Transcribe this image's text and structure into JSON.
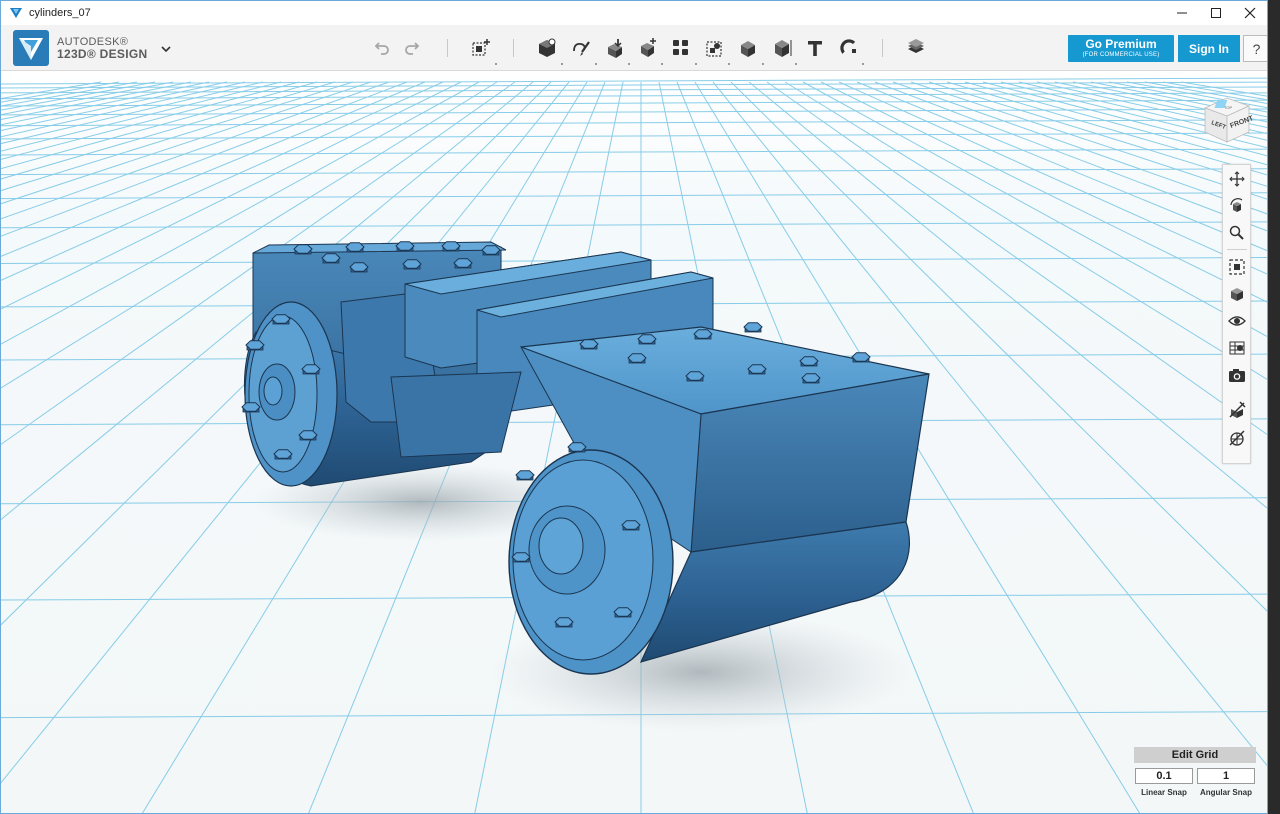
{
  "window": {
    "title": "cylinders_07",
    "controls": [
      "minimize-icon",
      "maximize-icon",
      "close-icon"
    ]
  },
  "brand": {
    "line1": "AUTODESK®",
    "line2": "123D® DESIGN"
  },
  "toolbar": {
    "tools": [
      "undo-icon",
      "redo-icon",
      "transform-icon",
      "primitives-icon",
      "sketch-icon",
      "construct-icon",
      "modify-icon",
      "pattern-icon",
      "group-icon",
      "combine-icon",
      "measure-icon",
      "text-icon",
      "snap-icon",
      "materials-icon"
    ],
    "premium_label": "Go Premium",
    "premium_sublabel": "(FOR COMMERCIAL USE)",
    "signin_label": "Sign In",
    "help_label": "?"
  },
  "viewcube": {
    "top_label": "TOP",
    "left_label": "LEFT",
    "front_label": "FRONT"
  },
  "navbar": {
    "tools": [
      "pan-icon",
      "orbit-icon",
      "zoom-icon",
      "fit-icon",
      "view-icon",
      "visibility-icon",
      "materials-view-icon",
      "screenshot-icon",
      "hide-sketch-icon",
      "hide-mesh-icon"
    ]
  },
  "grid": {
    "edit_label": "Edit Grid",
    "linear_snap_value": "0.1",
    "linear_snap_label": "Linear Snap",
    "angular_snap_value": "1",
    "angular_snap_label": "Angular Snap"
  },
  "colors": {
    "accent": "#1698d1",
    "model": "#4e92c6",
    "grid": "#7cc8e6"
  }
}
